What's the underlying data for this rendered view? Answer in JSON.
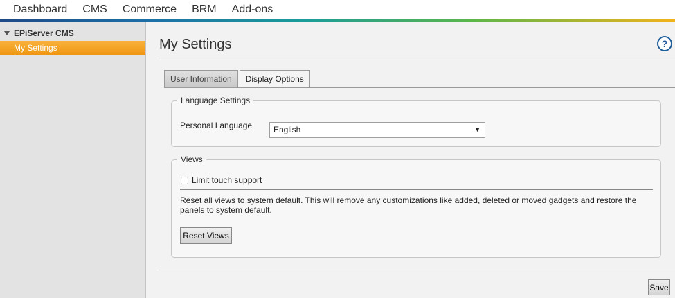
{
  "topnav": {
    "items": [
      "Dashboard",
      "CMS",
      "Commerce",
      "BRM",
      "Add-ons"
    ]
  },
  "sidebar": {
    "group_label": "EPiServer CMS",
    "selected_item": "My Settings"
  },
  "main": {
    "title": "My Settings",
    "help_glyph": "?",
    "tabs": [
      {
        "label": "User Information",
        "active": false
      },
      {
        "label": "Display Options",
        "active": true
      }
    ],
    "language_settings": {
      "legend": "Language Settings",
      "personal_language_label": "Personal Language",
      "personal_language_value": "English"
    },
    "views": {
      "legend": "Views",
      "limit_touch_label": "Limit touch support",
      "limit_touch_checked": false,
      "reset_description": "Reset all views to system default. This will remove any customizations like added, deleted or moved gadgets and restore the panels to system default.",
      "reset_button_label": "Reset Views"
    },
    "save_button_label": "Save"
  },
  "colors": {
    "selected_orange": "#f0a020",
    "help_blue": "#1f5d99"
  }
}
